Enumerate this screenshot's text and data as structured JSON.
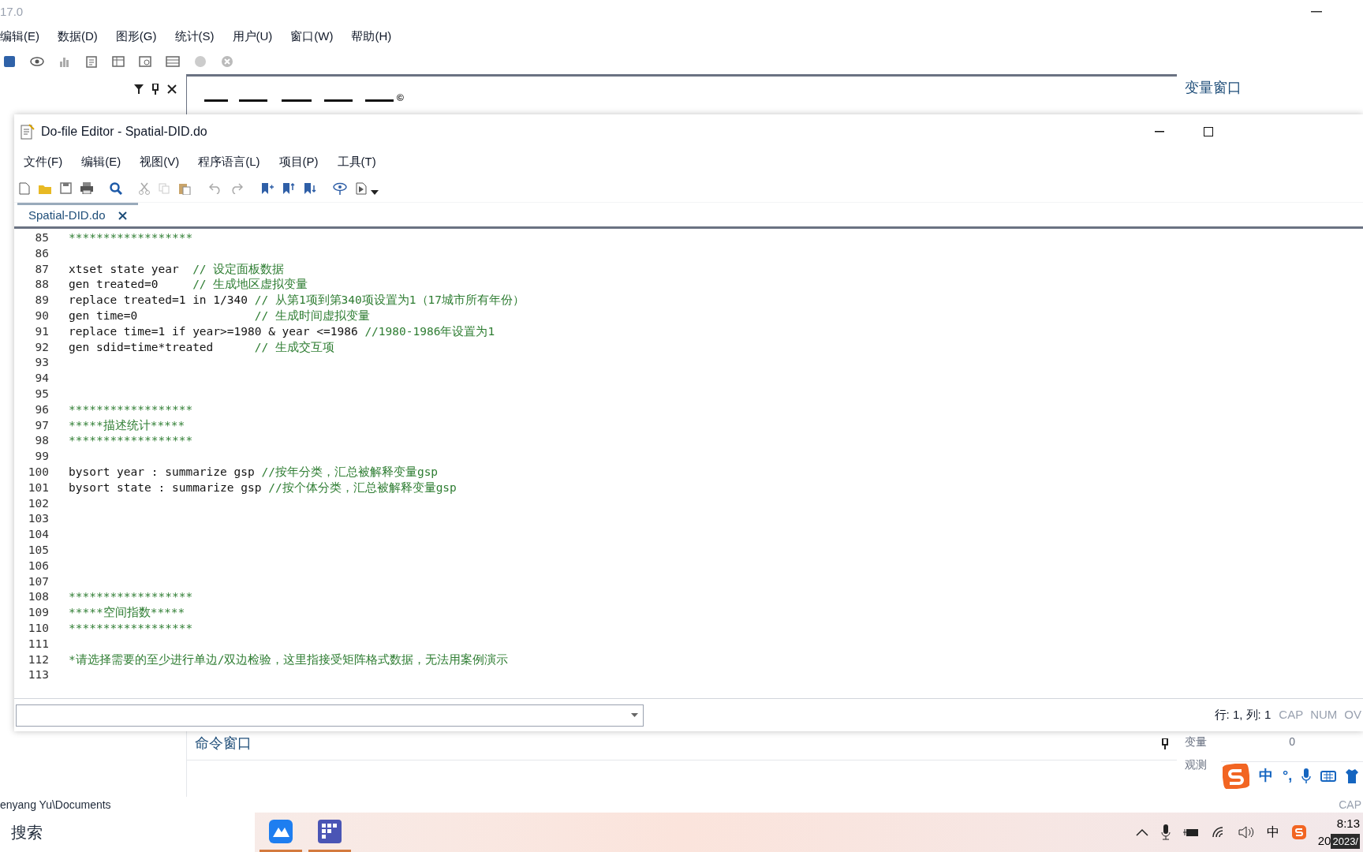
{
  "app": {
    "title": "17.0",
    "menus": [
      "编辑(E)",
      "数据(D)",
      "图形(G)",
      "统计(S)",
      "用户(U)",
      "窗口(W)",
      "帮助(H)"
    ],
    "results_mark": "©",
    "variables_title": "变量窗口",
    "properties": [
      {
        "label": "变量",
        "value": "0"
      },
      {
        "label": "观测"
      }
    ],
    "command_title": "命令窗口",
    "status_path": "enyang Yu\\Documents",
    "status_caps": "CAP"
  },
  "editor": {
    "title": "Do-file Editor - Spatial-DID.do",
    "menus": [
      "文件(F)",
      "编辑(E)",
      "视图(V)",
      "程序语言(L)",
      "项目(P)",
      "工具(T)"
    ],
    "tabs": [
      {
        "label": "Spatial-DID.do",
        "selected": true
      }
    ],
    "lines": [
      {
        "number": "85",
        "segments": [
          {
            "kind": "comment",
            "text": "******************"
          }
        ]
      },
      {
        "number": "86"
      },
      {
        "number": "87",
        "segments": [
          {
            "kind": "code",
            "text": "xtset state year  "
          },
          {
            "kind": "comment",
            "text": "// 设定面板数据"
          }
        ]
      },
      {
        "number": "88",
        "segments": [
          {
            "kind": "code",
            "text": "gen treated=0     "
          },
          {
            "kind": "comment",
            "text": "// 生成地区虚拟变量"
          }
        ]
      },
      {
        "number": "89",
        "segments": [
          {
            "kind": "code",
            "text": "replace treated=1 in 1/340 "
          },
          {
            "kind": "comment",
            "text": "// 从第1项到第340项设置为1（17城市所有年份）"
          }
        ]
      },
      {
        "number": "90",
        "segments": [
          {
            "kind": "code",
            "text": "gen time=0                 "
          },
          {
            "kind": "comment",
            "text": "// 生成时间虚拟变量"
          }
        ]
      },
      {
        "number": "91",
        "segments": [
          {
            "kind": "code",
            "text": "replace time=1 if year>=1980 & year <=1986 "
          },
          {
            "kind": "comment",
            "text": "//1980-1986年设置为1"
          }
        ]
      },
      {
        "number": "92",
        "segments": [
          {
            "kind": "code",
            "text": "gen sdid=time*treated      "
          },
          {
            "kind": "comment",
            "text": "// 生成交互项"
          }
        ]
      },
      {
        "number": "93"
      },
      {
        "number": "94"
      },
      {
        "number": "95"
      },
      {
        "number": "96",
        "segments": [
          {
            "kind": "comment",
            "text": "******************"
          }
        ]
      },
      {
        "number": "97",
        "segments": [
          {
            "kind": "comment",
            "text": "*****描述统计*****"
          }
        ]
      },
      {
        "number": "98",
        "segments": [
          {
            "kind": "comment",
            "text": "******************"
          }
        ]
      },
      {
        "number": "99"
      },
      {
        "number": "100",
        "segments": [
          {
            "kind": "code",
            "text": "bysort year : summarize gsp "
          },
          {
            "kind": "comment",
            "text": "//按年分类，汇总被解释变量gsp"
          }
        ]
      },
      {
        "number": "101",
        "segments": [
          {
            "kind": "code",
            "text": "bysort state : summarize gsp "
          },
          {
            "kind": "comment",
            "text": "//按个体分类，汇总被解释变量gsp"
          }
        ]
      },
      {
        "number": "102"
      },
      {
        "number": "103"
      },
      {
        "number": "104"
      },
      {
        "number": "105"
      },
      {
        "number": "106"
      },
      {
        "number": "107"
      },
      {
        "number": "108",
        "segments": [
          {
            "kind": "comment",
            "text": "******************"
          }
        ]
      },
      {
        "number": "109",
        "segments": [
          {
            "kind": "comment",
            "text": "*****空间指数*****"
          }
        ]
      },
      {
        "number": "110",
        "segments": [
          {
            "kind": "comment",
            "text": "******************"
          }
        ]
      },
      {
        "number": "111"
      },
      {
        "number": "112",
        "segments": [
          {
            "kind": "comment",
            "text": "*请选择需要的至少进行单边/双边检验，这里指接受矩阵格式数据，无法用案例演示"
          }
        ]
      },
      {
        "number": "113"
      }
    ],
    "position": "行: 1, 列: 1",
    "indicators": [
      {
        "label": "CAP",
        "on": false
      },
      {
        "label": "NUM",
        "on": false
      },
      {
        "label": "OV",
        "on": false
      }
    ]
  },
  "ime": {
    "mode": "中",
    "punct": "°,"
  },
  "taskbar": {
    "search_placeholder": "搜索",
    "tray_ime": "中",
    "time": "8:13",
    "date": "20",
    "date_tooltip": "2023/"
  }
}
